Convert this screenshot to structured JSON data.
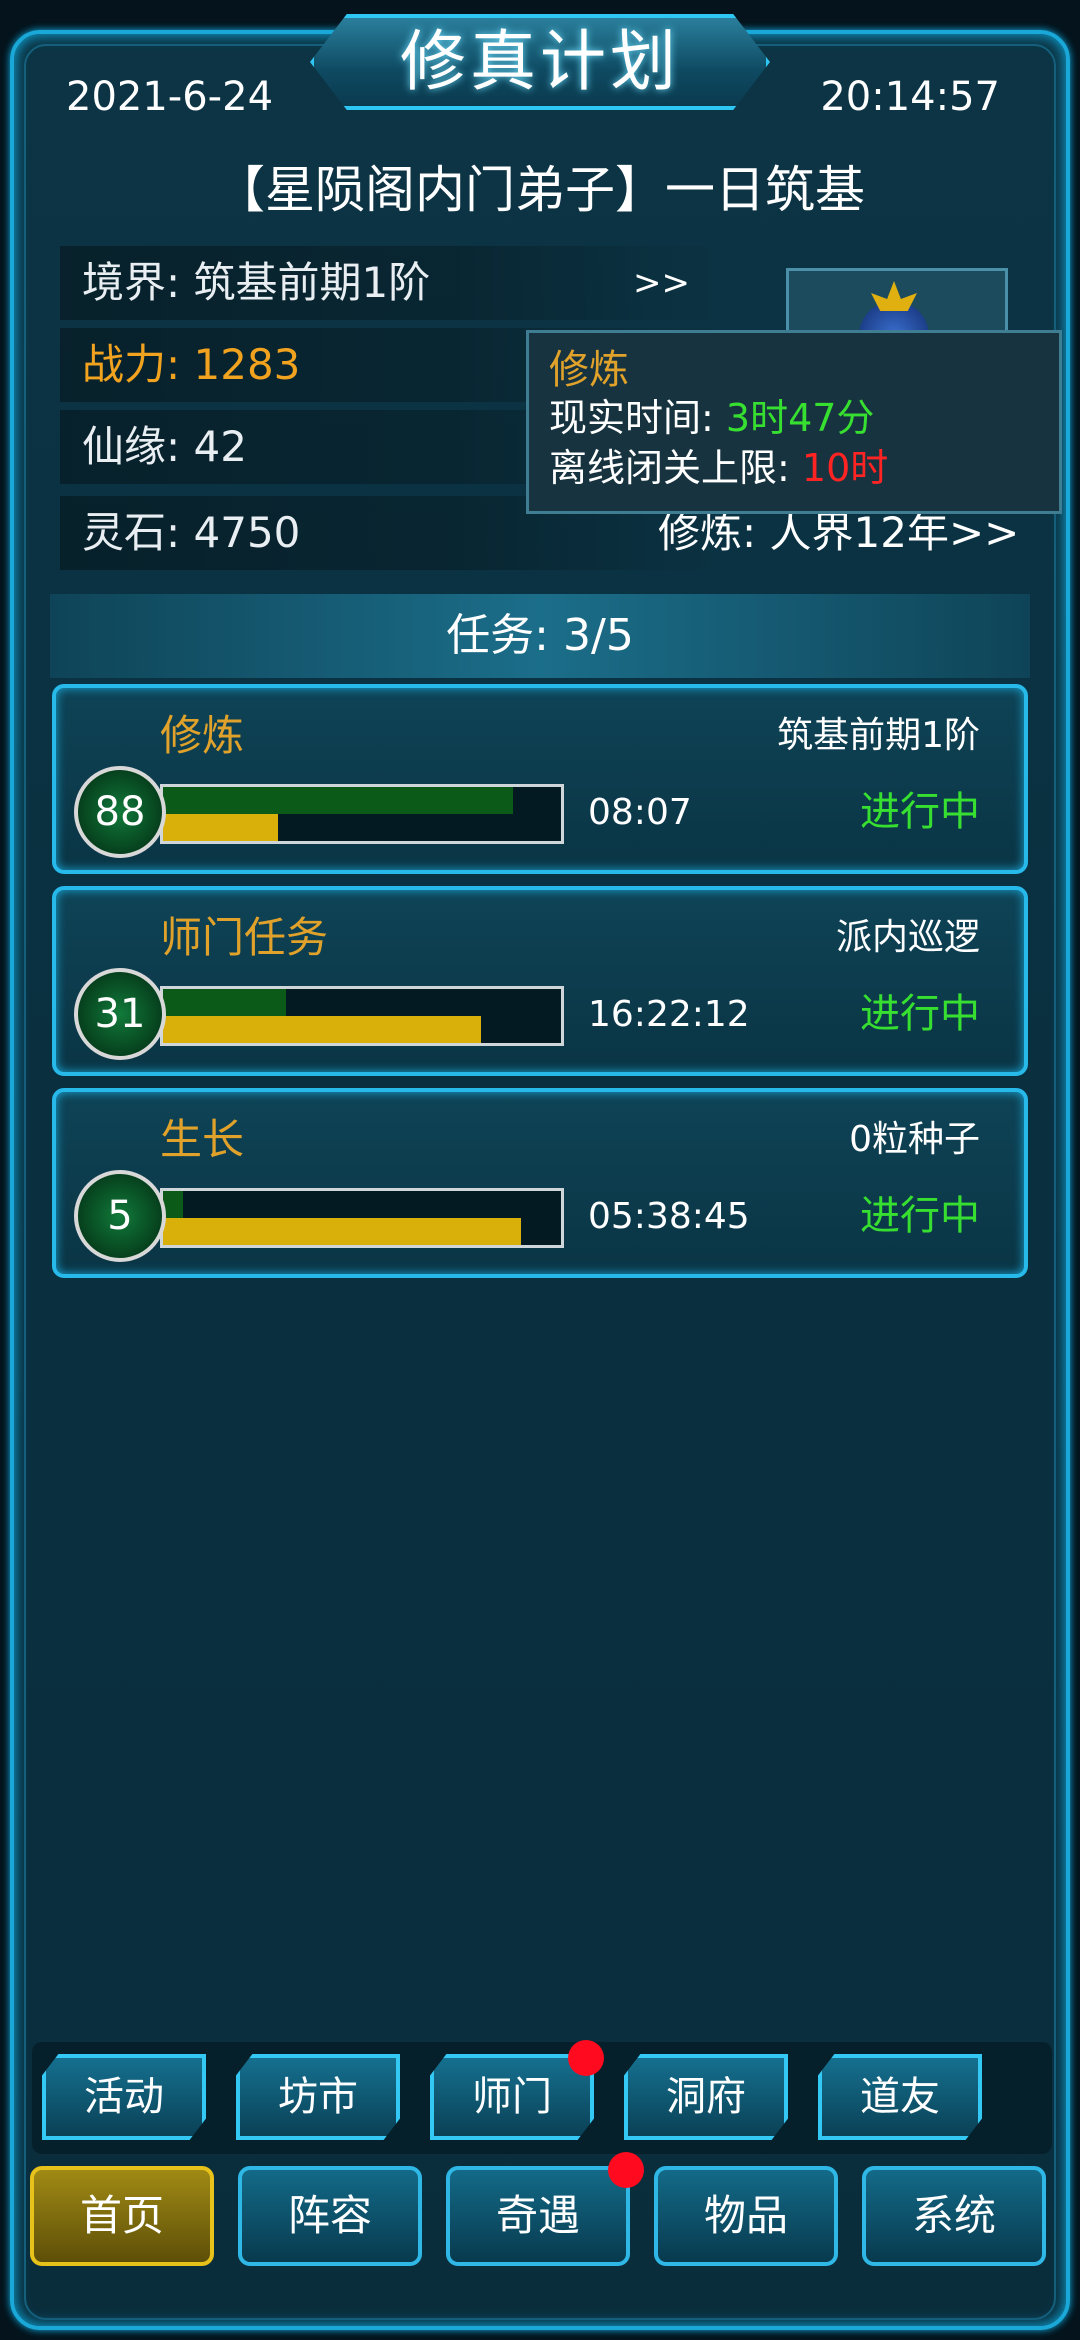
{
  "header": {
    "title": "修真计划",
    "date": "2021-6-24",
    "time": "20:14:57",
    "subtitle": "【星陨阁内门弟子】一日筑基"
  },
  "stats": {
    "realm": "境界: 筑基前期1阶",
    "realm_arrow": ">>",
    "power": "战力: 1283",
    "fate": "仙缘: 42",
    "spirit_stone": "灵石: 4750",
    "cultivate": "修炼: 人界12年>>"
  },
  "popup": {
    "title": "修炼",
    "real_time_label": "现实时间: ",
    "real_time_value": "3时47分",
    "offline_label": "离线闭关上限: ",
    "offline_value": "10时"
  },
  "tasks": {
    "header": "任务: 3/5",
    "items": [
      {
        "name": "修炼",
        "desc": "筑基前期1阶",
        "level": "88",
        "time": "08:07",
        "status": "进行中",
        "green_progress": 0.88,
        "yellow_progress": 0.29
      },
      {
        "name": "师门任务",
        "desc": "派内巡逻",
        "level": "31",
        "time": "16:22:12",
        "status": "进行中",
        "green_progress": 0.31,
        "yellow_progress": 0.8
      },
      {
        "name": "生长",
        "desc": "0粒种子",
        "level": "5",
        "time": "05:38:45",
        "status": "进行中",
        "green_progress": 0.05,
        "yellow_progress": 0.9
      }
    ]
  },
  "tabs": {
    "items": [
      {
        "label": "活动",
        "badge": false
      },
      {
        "label": "坊市",
        "badge": false
      },
      {
        "label": "师门",
        "badge": true
      },
      {
        "label": "洞府",
        "badge": false
      },
      {
        "label": "道友",
        "badge": false
      }
    ]
  },
  "nav": {
    "items": [
      {
        "label": "首页",
        "active": true
      },
      {
        "label": "阵容",
        "active": false
      },
      {
        "label": "奇遇",
        "badge": true
      },
      {
        "label": "物品",
        "active": false
      },
      {
        "label": "系统",
        "active": false
      }
    ]
  },
  "colors": {
    "accent": "#27b9ea",
    "orange_text": "#f1a21e",
    "status_green": "#37e030",
    "alert_red": "#ff2424",
    "progress_green": "#0b5a17",
    "progress_yellow": "#d8b009",
    "active_nav": "#a08a14"
  }
}
